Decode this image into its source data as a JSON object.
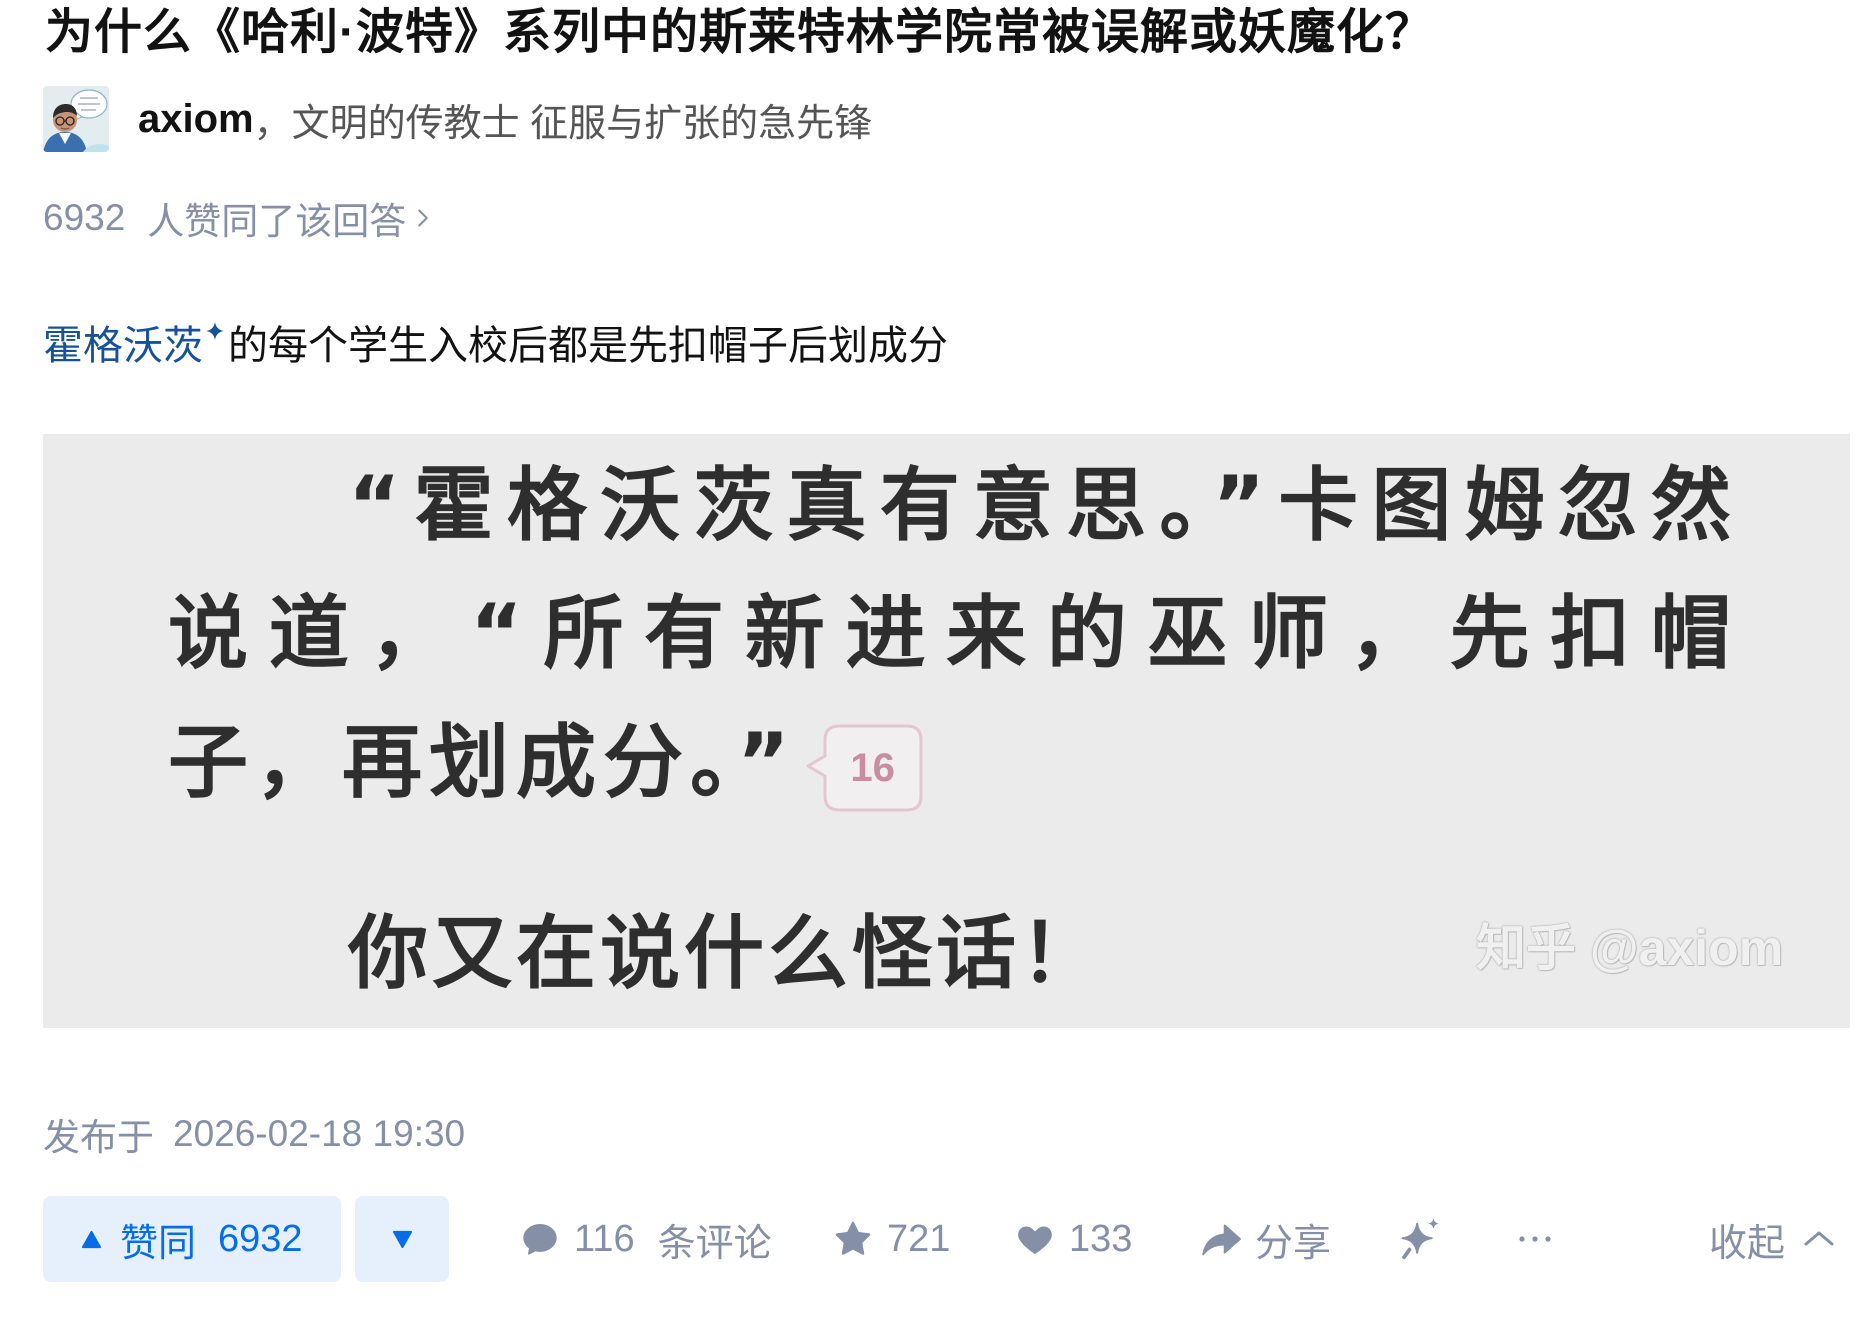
{
  "question": {
    "title": "为什么《哈利·波特》系列中的斯莱特林学院常被误解或妖魔化？"
  },
  "author": {
    "name": "axiom",
    "separator": "，",
    "headline": "文明的传教士 征服与扩张的急先锋",
    "avatar_icon": "avatar-image"
  },
  "answer": {
    "voteup_summary": {
      "count": "6932",
      "label": "人赞同了该回答",
      "icon": "chevron-right-icon"
    },
    "content": {
      "link_text": "霍格沃茨",
      "link_badge_icon": "sparkle-icon",
      "text": "的每个学生入校后都是先扣帽子后划成分"
    },
    "figure": {
      "lines": [
        "“霍格沃茨真有意思。”卡图姆忽然",
        "说道，“所有新进来的巫师，先扣帽",
        "子，再划成分。”"
      ],
      "comment_bubble": "16",
      "reply_line": "你又在说什么怪话！",
      "watermark": "知乎 @axiom"
    },
    "published": {
      "label": "发布于",
      "time": "2026-02-18 19:30"
    }
  },
  "actions": {
    "vote_up": {
      "label": "赞同",
      "count": "6932",
      "icon": "triangle-up-icon"
    },
    "vote_down": {
      "icon": "triangle-down-icon"
    },
    "comments": {
      "count": "116",
      "label": "条评论",
      "icon": "comment-icon"
    },
    "favorites": {
      "count": "721",
      "icon": "star-icon"
    },
    "likes": {
      "count": "133",
      "icon": "heart-icon"
    },
    "share": {
      "label": "分享",
      "icon": "share-icon"
    },
    "ai": {
      "icon": "sparkle-icon"
    },
    "more": {
      "icon": "more-icon"
    },
    "collapse": {
      "label": "收起",
      "icon": "chevron-up-icon"
    }
  },
  "colors": {
    "accent": "#056de8",
    "accent_bg": "#e6f0fd",
    "gray": "#8590a6",
    "link": "#175199",
    "text": "#121212",
    "headline": "#555555",
    "figure_bg": "#ebebeb",
    "figure_text": "#2e2e2e",
    "bubble_text": "#c98ca0"
  }
}
